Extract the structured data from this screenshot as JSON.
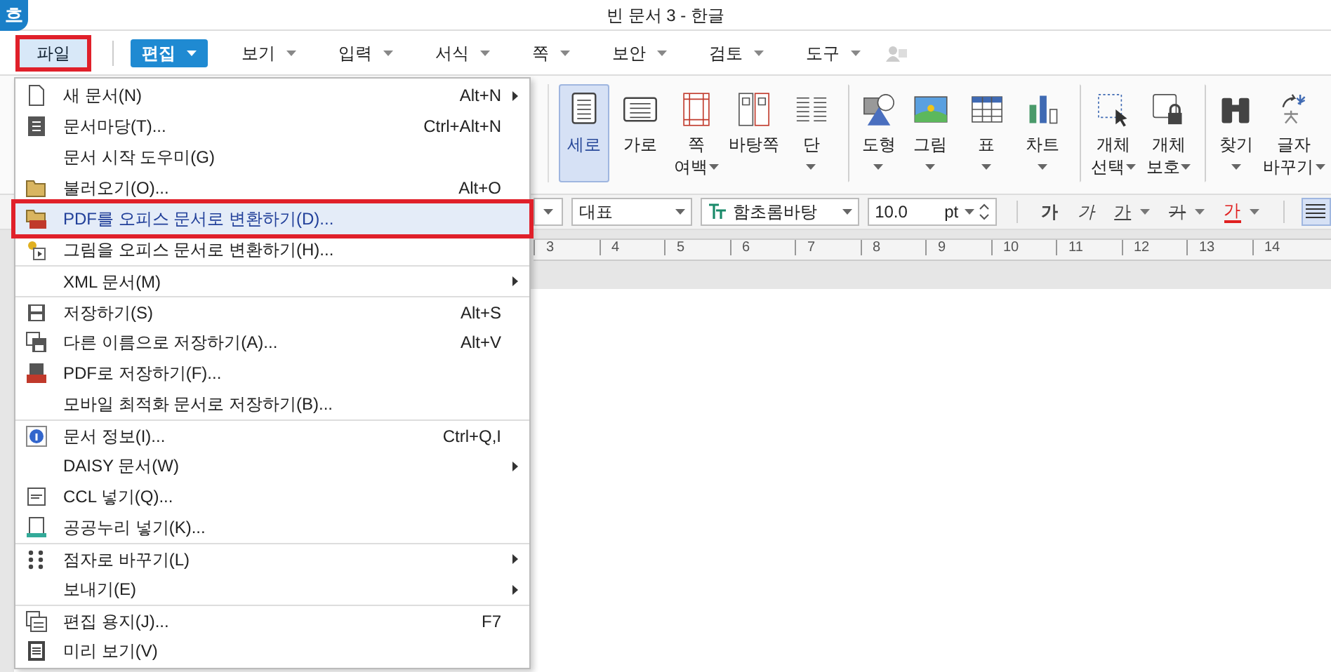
{
  "window": {
    "logo": "흐",
    "title": "빈 문서 3 - 한글"
  },
  "menu_bar": [
    {
      "label": "파일",
      "kind": "plain",
      "selected": true,
      "annotated": true
    },
    {
      "label": "편집",
      "kind": "dropdown-button",
      "selected": false,
      "annotated": false
    },
    {
      "label": "보기",
      "kind": "dropdown",
      "selected": false,
      "annotated": false
    },
    {
      "label": "입력",
      "kind": "dropdown",
      "selected": false,
      "annotated": false
    },
    {
      "label": "서식",
      "kind": "dropdown",
      "selected": false,
      "annotated": false
    },
    {
      "label": "쪽",
      "kind": "dropdown",
      "selected": false,
      "annotated": false
    },
    {
      "label": "보안",
      "kind": "dropdown",
      "selected": false,
      "annotated": false
    },
    {
      "label": "검토",
      "kind": "dropdown",
      "selected": false,
      "annotated": false
    },
    {
      "label": "도구",
      "kind": "dropdown",
      "selected": false,
      "annotated": false
    }
  ],
  "toolbar": [
    {
      "lines": [
        "세로"
      ],
      "dropdown": false,
      "selected": true,
      "group_start": false
    },
    {
      "lines": [
        "가로"
      ],
      "dropdown": false,
      "selected": false,
      "group_start": false
    },
    {
      "lines": [
        "쪽",
        "여백"
      ],
      "dropdown": true,
      "selected": false,
      "group_start": false
    },
    {
      "lines": [
        "바탕쪽"
      ],
      "dropdown": false,
      "selected": false,
      "group_start": false
    },
    {
      "lines": [
        "단"
      ],
      "dropdown": true,
      "selected": false,
      "group_start": false
    },
    {
      "lines": [
        "도형"
      ],
      "dropdown": true,
      "selected": false,
      "group_start": true
    },
    {
      "lines": [
        "그림"
      ],
      "dropdown": true,
      "selected": false,
      "group_start": false
    },
    {
      "lines": [
        "표"
      ],
      "dropdown": true,
      "selected": false,
      "group_start": false
    },
    {
      "lines": [
        "차트"
      ],
      "dropdown": true,
      "selected": false,
      "group_start": false
    },
    {
      "lines": [
        "개체",
        "선택"
      ],
      "dropdown": true,
      "selected": false,
      "group_start": true
    },
    {
      "lines": [
        "개체",
        "보호"
      ],
      "dropdown": true,
      "selected": false,
      "group_start": false
    },
    {
      "lines": [
        "찾기"
      ],
      "dropdown": true,
      "selected": false,
      "group_start": true
    },
    {
      "lines": [
        "글자",
        "바꾸기"
      ],
      "dropdown": true,
      "selected": false,
      "group_start": false
    }
  ],
  "format_bar": {
    "style": "대표",
    "font": "함초롬바탕",
    "size": "10.0",
    "unit": "pt",
    "char_buttons": [
      {
        "label": "가",
        "kind": "bold",
        "dropdown": false
      },
      {
        "label": "가",
        "kind": "italic",
        "dropdown": false
      },
      {
        "label": "가",
        "kind": "underline",
        "dropdown": true
      },
      {
        "label": "가",
        "kind": "strike",
        "dropdown": true
      },
      {
        "label": "가",
        "kind": "color",
        "dropdown": true
      }
    ],
    "align_selected": true
  },
  "ruler": [
    "3",
    "4",
    "5",
    "6",
    "7",
    "8",
    "9",
    "10",
    "11",
    "12",
    "13",
    "14"
  ],
  "file_menu": [
    {
      "label": "새 문서(N)",
      "shortcut": "Alt+N",
      "submenu": true,
      "selected": false,
      "separator_before": false
    },
    {
      "label": "문서마당(T)...",
      "shortcut": "Ctrl+Alt+N",
      "submenu": false,
      "selected": false,
      "separator_before": false
    },
    {
      "label": "문서 시작 도우미(G)",
      "submenu": false,
      "selected": false,
      "separator_before": false
    },
    {
      "label": "불러오기(O)...",
      "shortcut": "Alt+O",
      "submenu": false,
      "selected": false,
      "separator_before": false
    },
    {
      "label": "PDF를 오피스 문서로 변환하기(D)...",
      "submenu": false,
      "selected": true,
      "separator_before": false
    },
    {
      "label": "그림을 오피스 문서로 변환하기(H)...",
      "submenu": false,
      "selected": false,
      "separator_before": false
    },
    {
      "label": "XML 문서(M)",
      "submenu": true,
      "selected": false,
      "separator_before": true
    },
    {
      "label": "저장하기(S)",
      "shortcut": "Alt+S",
      "submenu": false,
      "selected": false,
      "separator_before": true
    },
    {
      "label": "다른 이름으로 저장하기(A)...",
      "shortcut": "Alt+V",
      "submenu": false,
      "selected": false,
      "separator_before": false
    },
    {
      "label": "PDF로 저장하기(F)...",
      "submenu": false,
      "selected": false,
      "separator_before": false
    },
    {
      "label": "모바일 최적화 문서로 저장하기(B)...",
      "submenu": false,
      "selected": false,
      "separator_before": false
    },
    {
      "label": "문서 정보(I)...",
      "shortcut": "Ctrl+Q,I",
      "submenu": false,
      "selected": false,
      "separator_before": true
    },
    {
      "label": "DAISY 문서(W)",
      "submenu": true,
      "selected": false,
      "separator_before": false
    },
    {
      "label": "CCL 넣기(Q)...",
      "submenu": false,
      "selected": false,
      "separator_before": false
    },
    {
      "label": "공공누리 넣기(K)...",
      "submenu": false,
      "selected": false,
      "separator_before": false
    },
    {
      "label": "점자로 바꾸기(L)",
      "submenu": true,
      "selected": false,
      "separator_before": true
    },
    {
      "label": "보내기(E)",
      "submenu": true,
      "selected": false,
      "separator_before": false
    },
    {
      "label": "편집 용지(J)...",
      "shortcut": "F7",
      "submenu": false,
      "selected": false,
      "separator_before": true
    },
    {
      "label": "미리 보기(V)",
      "submenu": false,
      "selected": false,
      "separator_before": false
    }
  ]
}
